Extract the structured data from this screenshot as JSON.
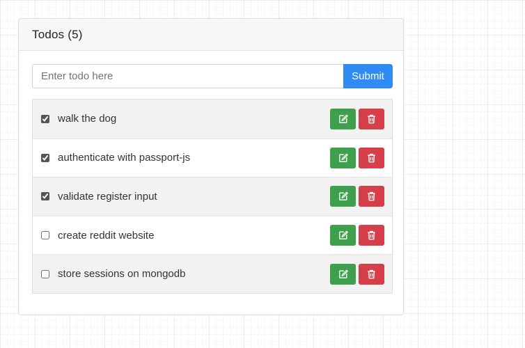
{
  "header": {
    "title": "Todos (5)"
  },
  "form": {
    "placeholder": "Enter todo here",
    "value": "",
    "submit_label": "Submit"
  },
  "todos": [
    {
      "text": "walk the dog",
      "done": true
    },
    {
      "text": "authenticate with passport-js",
      "done": true
    },
    {
      "text": "validate register input",
      "done": true
    },
    {
      "text": "create reddit website",
      "done": false
    },
    {
      "text": "store sessions on mongodb",
      "done": false
    }
  ],
  "icons": {
    "edit": "edit-icon",
    "delete": "trash-icon"
  },
  "colors": {
    "submit": "#2f8cf5",
    "edit": "#3ea04d",
    "delete": "#d63f49"
  }
}
